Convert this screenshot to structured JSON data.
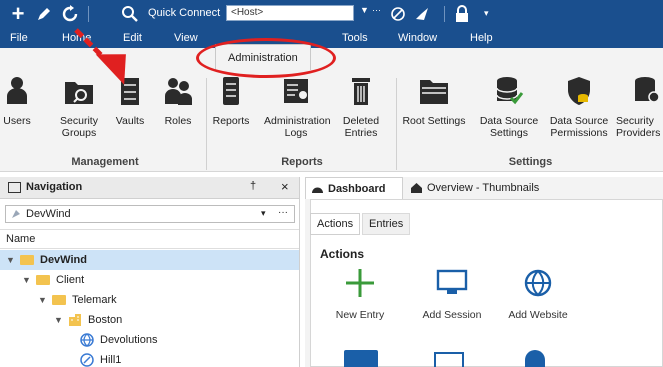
{
  "toolbar": {
    "quick_connect_label": "Quick Connect",
    "host_placeholder": "<Host>"
  },
  "menu": [
    "File",
    "Home",
    "Edit",
    "View",
    "Administration",
    "Tools",
    "Window",
    "Help"
  ],
  "ribbon": {
    "groups": {
      "management": "Management",
      "reports": "Reports",
      "settings": "Settings"
    },
    "buttons": {
      "users": "Users",
      "security_groups": "Security Groups",
      "vaults": "Vaults",
      "roles": "Roles",
      "reports": "Reports",
      "administration_logs": "Administration Logs",
      "deleted_entries": "Deleted Entries",
      "root_settings": "Root Settings",
      "data_source_settings": "Data Source Settings",
      "data_source_permissions": "Data Source Permissions",
      "security_providers": "Security Providers"
    }
  },
  "navigation": {
    "title": "Navigation",
    "pin": "†",
    "close": "×",
    "datasource": "DevWind",
    "column_header": "Name",
    "tree": [
      "DevWind",
      "Client",
      "Telemark",
      "Boston",
      "Devolutions",
      "Hill1"
    ]
  },
  "dashboard": {
    "tabs": [
      "Dashboard",
      "Overview - Thumbnails"
    ],
    "subtabs": [
      "Actions",
      "Entries"
    ],
    "section_title": "Actions",
    "actions": [
      "New Entry",
      "Add Session",
      "Add Website"
    ]
  },
  "colors": {
    "titlebar": "#1a4f8e",
    "ribbon_bg": "#f3f3f3",
    "selection": "#cde3f7",
    "annotation": "#e02020",
    "green_plus": "#3a9a3a",
    "icon_dark": "#2b2b2b"
  }
}
